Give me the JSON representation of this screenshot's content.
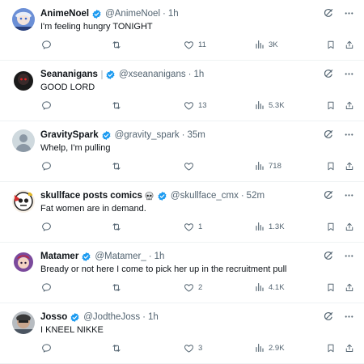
{
  "colors": {
    "verified": "#1d9bf0",
    "icon": "#536471",
    "text": "#0f1419",
    "divider": "#eff3f4"
  },
  "icons": {
    "verified": "verified-badge-icon",
    "reply": "reply-icon",
    "repost": "repost-icon",
    "like": "heart-icon",
    "views": "views-icon",
    "bookmark": "bookmark-icon",
    "share": "share-icon",
    "grok": "grok-icon",
    "more": "more-icon"
  },
  "tweets": [
    {
      "name": "AnimeNoel",
      "handle": "@AnimeNoel",
      "time": "1h",
      "text": "I'm feeling hungry TONIGHT",
      "replies": "",
      "reposts": "",
      "likes": "11",
      "views": "3K"
    },
    {
      "name": "Seananigans",
      "handle": "@xseananigans",
      "time": "1h",
      "text": "GOOD LORD",
      "replies": "",
      "reposts": "",
      "likes": "13",
      "views": "5.3K"
    },
    {
      "name": "GravitySpark",
      "handle": "@gravity_spark",
      "time": "35m",
      "text": "Whelp, I'm pulling",
      "replies": "",
      "reposts": "",
      "likes": "",
      "views": "718"
    },
    {
      "name": "skullface posts comics",
      "handle": "@skullface_cmx",
      "time": "52m",
      "text": "Fat women are in demand.",
      "replies": "",
      "reposts": "",
      "likes": "1",
      "views": "1.3K"
    },
    {
      "name": "Matamer",
      "handle": "@Matamer_",
      "time": "1h",
      "text": "Bready or not here I come to pick her up in the recruitment pull",
      "replies": "",
      "reposts": "",
      "likes": "2",
      "views": "4.1K"
    },
    {
      "name": "Josso",
      "handle": "@JodtheJoss",
      "time": "1h",
      "text": "I KNEEL NIKKE",
      "replies": "",
      "reposts": "",
      "likes": "3",
      "views": "2.9K"
    }
  ]
}
